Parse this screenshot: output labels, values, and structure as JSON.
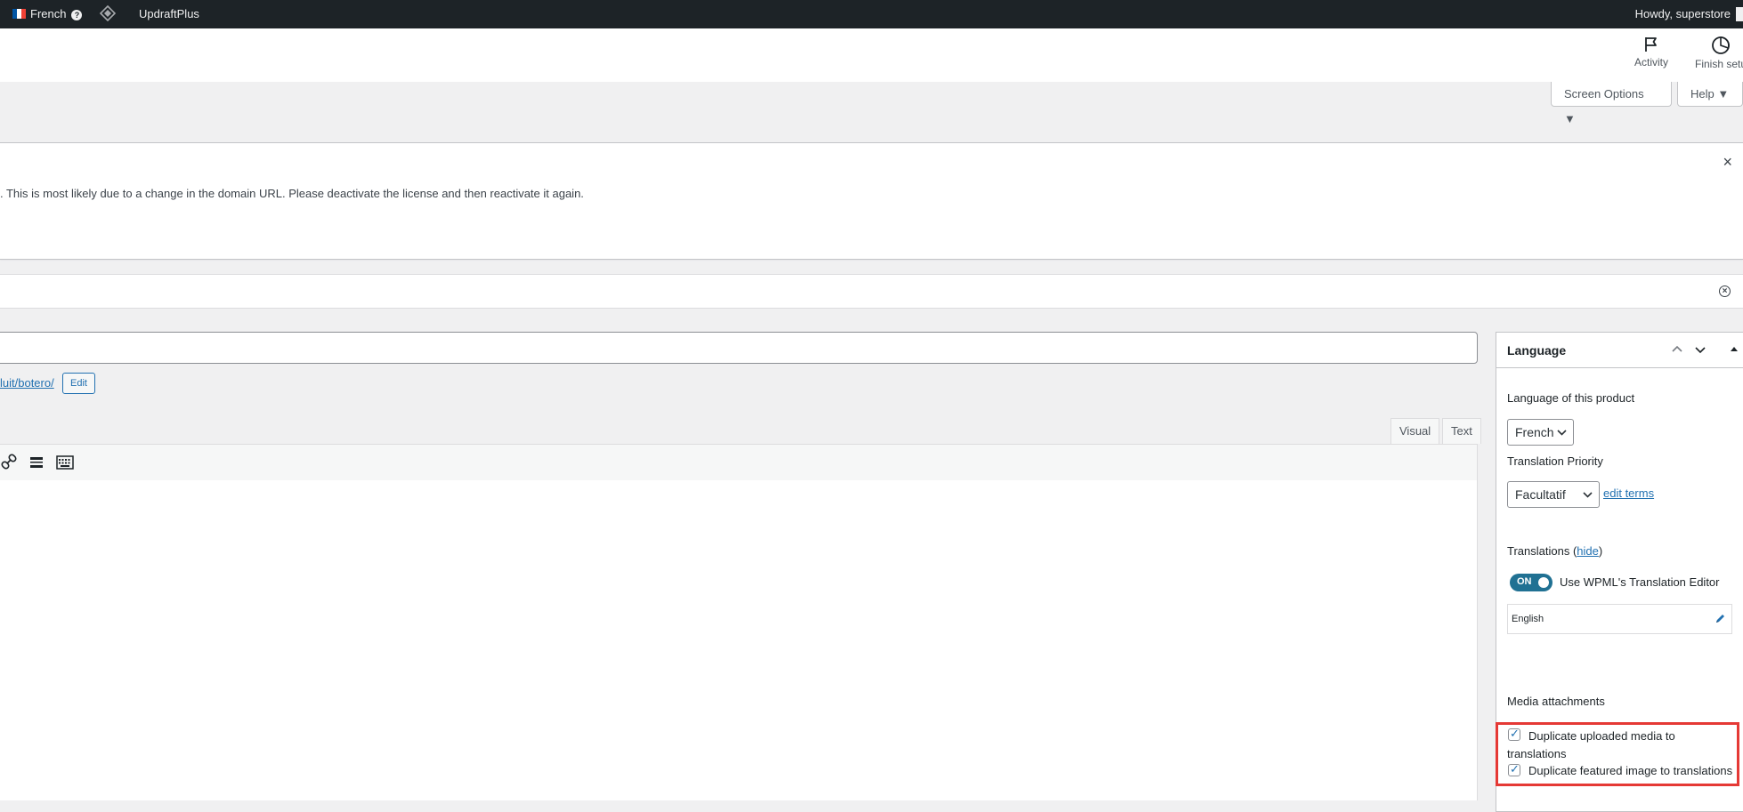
{
  "admin_bar": {
    "language": "French",
    "plugin": "UpdraftPlus",
    "greeting": "Howdy, superstore"
  },
  "wc_header": {
    "activity_label": "Activity",
    "finish_setup_label": "Finish setu"
  },
  "screen_tabs": {
    "screen_options": "Screen Options ▼",
    "help": "Help ▼"
  },
  "notice": {
    "message": ". This is most likely due to a change in the domain URL. Please deactivate the license and then reactivate it again.",
    "close": "×"
  },
  "editor": {
    "permalink_fragment": "luit/botero/",
    "edit_label": "Edit",
    "tab_visual": "Visual",
    "tab_text": "Text"
  },
  "language_box": {
    "title": "Language",
    "language_of_product_label": "Language of this product",
    "language_value": "French",
    "translation_priority_label": "Translation Priority",
    "priority_value": "Facultatif",
    "edit_terms_link": "edit terms",
    "translations_label": "Translations (",
    "hide_link": "hide",
    "translations_label_end": ")",
    "toggle_state": "ON",
    "use_wpml_label": "Use WPML's Translation Editor",
    "translation_languages": [
      "English"
    ],
    "media_attachments_label": "Media attachments",
    "dup_uploaded_media": "Duplicate uploaded media to translations",
    "dup_featured_image": "Duplicate featured image to translations"
  },
  "colors": {
    "admin_bar_bg": "#1d2327",
    "link_blue": "#2271b1",
    "toggle_teal": "#207193",
    "highlight_red": "#e53935"
  }
}
